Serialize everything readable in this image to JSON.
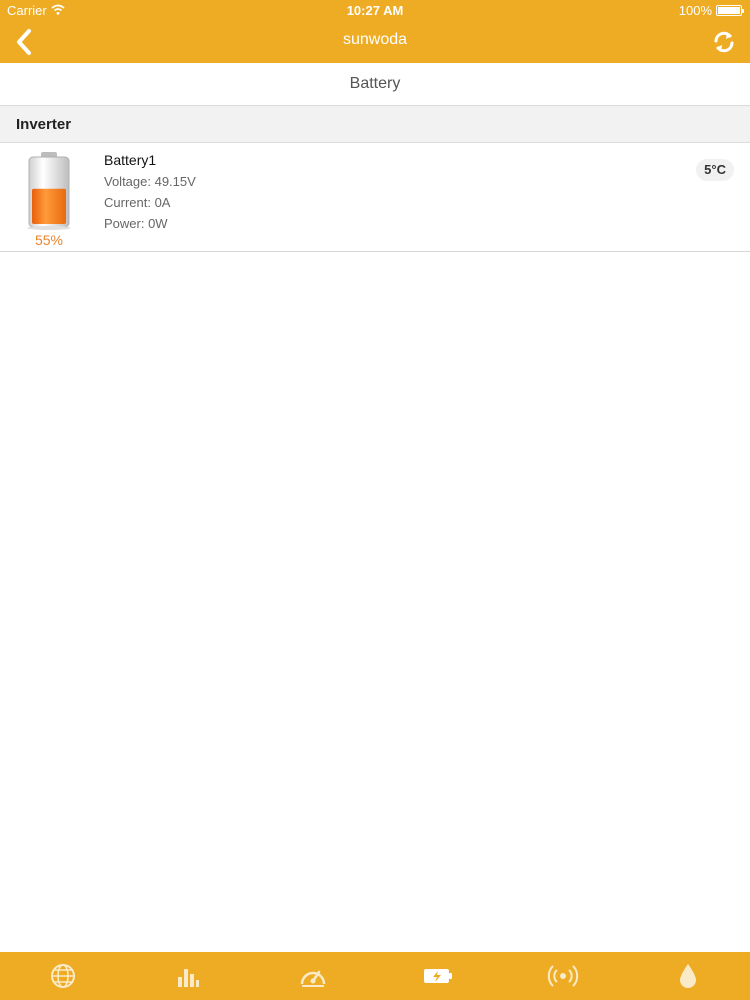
{
  "status": {
    "carrier": "Carrier",
    "time": "10:27 AM",
    "battery": "100%"
  },
  "nav": {
    "title": "sunwoda",
    "back_icon": "chevron-left-icon",
    "refresh_icon": "refresh-icon"
  },
  "segment": {
    "title": "Battery"
  },
  "section": {
    "title": "Inverter"
  },
  "battery": {
    "name": "Battery1",
    "voltage": "Voltage: 49.15V",
    "current": "Current: 0A",
    "power": "Power: 0W",
    "percent_label": "55%",
    "charge_level": 0.55,
    "temperature": "5°C"
  },
  "tabs": [
    {
      "icon": "globe-icon"
    },
    {
      "icon": "bar-chart-icon"
    },
    {
      "icon": "gauge-icon"
    },
    {
      "icon": "battery-bolt-icon",
      "active": true
    },
    {
      "icon": "broadcast-icon"
    },
    {
      "icon": "drop-icon"
    }
  ],
  "colors": {
    "accent": "#eeac25",
    "battery_fill": "#f07a1a",
    "percent_text": "#e9862c"
  }
}
